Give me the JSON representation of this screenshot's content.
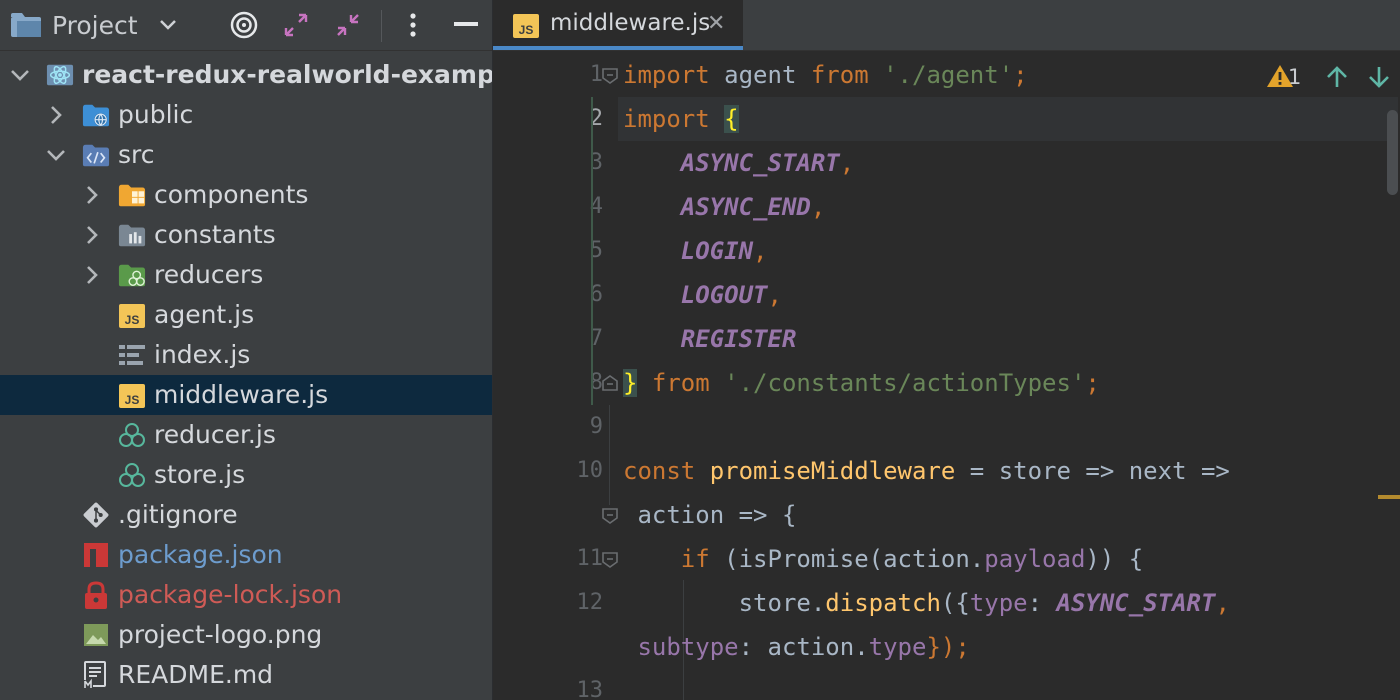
{
  "project_panel": {
    "title": "Project",
    "tree": [
      {
        "label": "react-redux-realworld-exampl",
        "icon": "react-module-icon",
        "arrow": "down",
        "depth": 0,
        "style": "bold"
      },
      {
        "label": "public",
        "icon": "folder-web-icon",
        "arrow": "right",
        "depth": 1
      },
      {
        "label": "src",
        "icon": "folder-source-icon",
        "arrow": "down",
        "depth": 1
      },
      {
        "label": "components",
        "icon": "folder-components-icon",
        "arrow": "right",
        "depth": 2
      },
      {
        "label": "constants",
        "icon": "folder-constants-icon",
        "arrow": "right",
        "depth": 2
      },
      {
        "label": "reducers",
        "icon": "folder-reducers-icon",
        "arrow": "right",
        "depth": 2
      },
      {
        "label": "agent.js",
        "icon": "js-file-icon",
        "depth": 2
      },
      {
        "label": "index.js",
        "icon": "text-file-icon",
        "depth": 2
      },
      {
        "label": "middleware.js",
        "icon": "js-file-icon",
        "depth": 2,
        "selected": true
      },
      {
        "label": "reducer.js",
        "icon": "redux-file-icon",
        "depth": 2
      },
      {
        "label": "store.js",
        "icon": "redux-file-icon",
        "depth": 2
      },
      {
        "label": ".gitignore",
        "icon": "git-icon",
        "depth": 1
      },
      {
        "label": "package.json",
        "icon": "npm-icon",
        "depth": 1,
        "style": "blue"
      },
      {
        "label": "package-lock.json",
        "icon": "lock-icon",
        "depth": 1,
        "style": "red"
      },
      {
        "label": "project-logo.png",
        "icon": "image-file-icon",
        "depth": 1
      },
      {
        "label": "README.md",
        "icon": "markdown-file-icon",
        "depth": 1
      }
    ]
  },
  "editor": {
    "tab": {
      "label": "middleware.js",
      "icon": "js-file-icon",
      "close": "✕"
    },
    "inspection": {
      "warnings": "1",
      "icons": [
        "warning-icon",
        "arrow-up-icon",
        "arrow-down-icon"
      ]
    },
    "line_numbers": [
      "1",
      "2",
      "3",
      "4",
      "5",
      "6",
      "7",
      "8",
      "9",
      "10",
      "",
      "11",
      "12",
      "",
      "13"
    ],
    "active_line": "2",
    "code_lines": [
      [
        {
          "t": "import",
          "c": "kw"
        },
        {
          "t": " agent "
        },
        {
          "t": "from",
          "c": "kw"
        },
        {
          "t": " "
        },
        {
          "t": "'./agent'",
          "c": "str"
        },
        {
          "t": ";",
          "c": "kw"
        }
      ],
      [
        {
          "t": "import",
          "c": "kw"
        },
        {
          "t": " "
        },
        {
          "t": "{",
          "c": "brace-hl"
        }
      ],
      [
        {
          "t": "    "
        },
        {
          "t": "ASYNC_START",
          "c": "const"
        },
        {
          "t": ",",
          "c": "kw"
        }
      ],
      [
        {
          "t": "    "
        },
        {
          "t": "ASYNC_END",
          "c": "const"
        },
        {
          "t": ",",
          "c": "kw"
        }
      ],
      [
        {
          "t": "    "
        },
        {
          "t": "LOGIN",
          "c": "const"
        },
        {
          "t": ",",
          "c": "kw"
        }
      ],
      [
        {
          "t": "    "
        },
        {
          "t": "LOGOUT",
          "c": "const"
        },
        {
          "t": ",",
          "c": "kw"
        }
      ],
      [
        {
          "t": "    "
        },
        {
          "t": "REGISTER",
          "c": "const"
        }
      ],
      [
        {
          "t": "}",
          "c": "brace-hl"
        },
        {
          "t": " "
        },
        {
          "t": "from",
          "c": "kw"
        },
        {
          "t": " "
        },
        {
          "t": "'./constants/actionTypes'",
          "c": "str"
        },
        {
          "t": ";",
          "c": "kw"
        }
      ],
      [],
      [
        {
          "t": "const",
          "c": "kw"
        },
        {
          "t": " "
        },
        {
          "t": "promiseMiddleware",
          "c": "fn"
        },
        {
          "t": " = store => next =>"
        }
      ],
      [
        {
          "t": " action => {"
        }
      ],
      [
        {
          "t": "    "
        },
        {
          "t": "if",
          "c": "kw"
        },
        {
          "t": " (isPromise(action."
        },
        {
          "t": "payload",
          "c": "prop"
        },
        {
          "t": ")) {"
        }
      ],
      [
        {
          "t": "        store."
        },
        {
          "t": "dispatch",
          "c": "fn"
        },
        {
          "t": "({"
        },
        {
          "t": "type",
          "c": "prop"
        },
        {
          "t": ": "
        },
        {
          "t": "ASYNC_START",
          "c": "const"
        },
        {
          "t": ",",
          "c": "kw"
        }
      ],
      [
        {
          "t": " "
        },
        {
          "t": "subtype",
          "c": "prop"
        },
        {
          "t": ": action."
        },
        {
          "t": "type",
          "c": "prop"
        },
        {
          "t": "});",
          "c": "kw"
        }
      ],
      []
    ]
  },
  "colors": {
    "accent": "#4a88c7",
    "selection": "#0d293e",
    "warning": "#e2a32b"
  }
}
